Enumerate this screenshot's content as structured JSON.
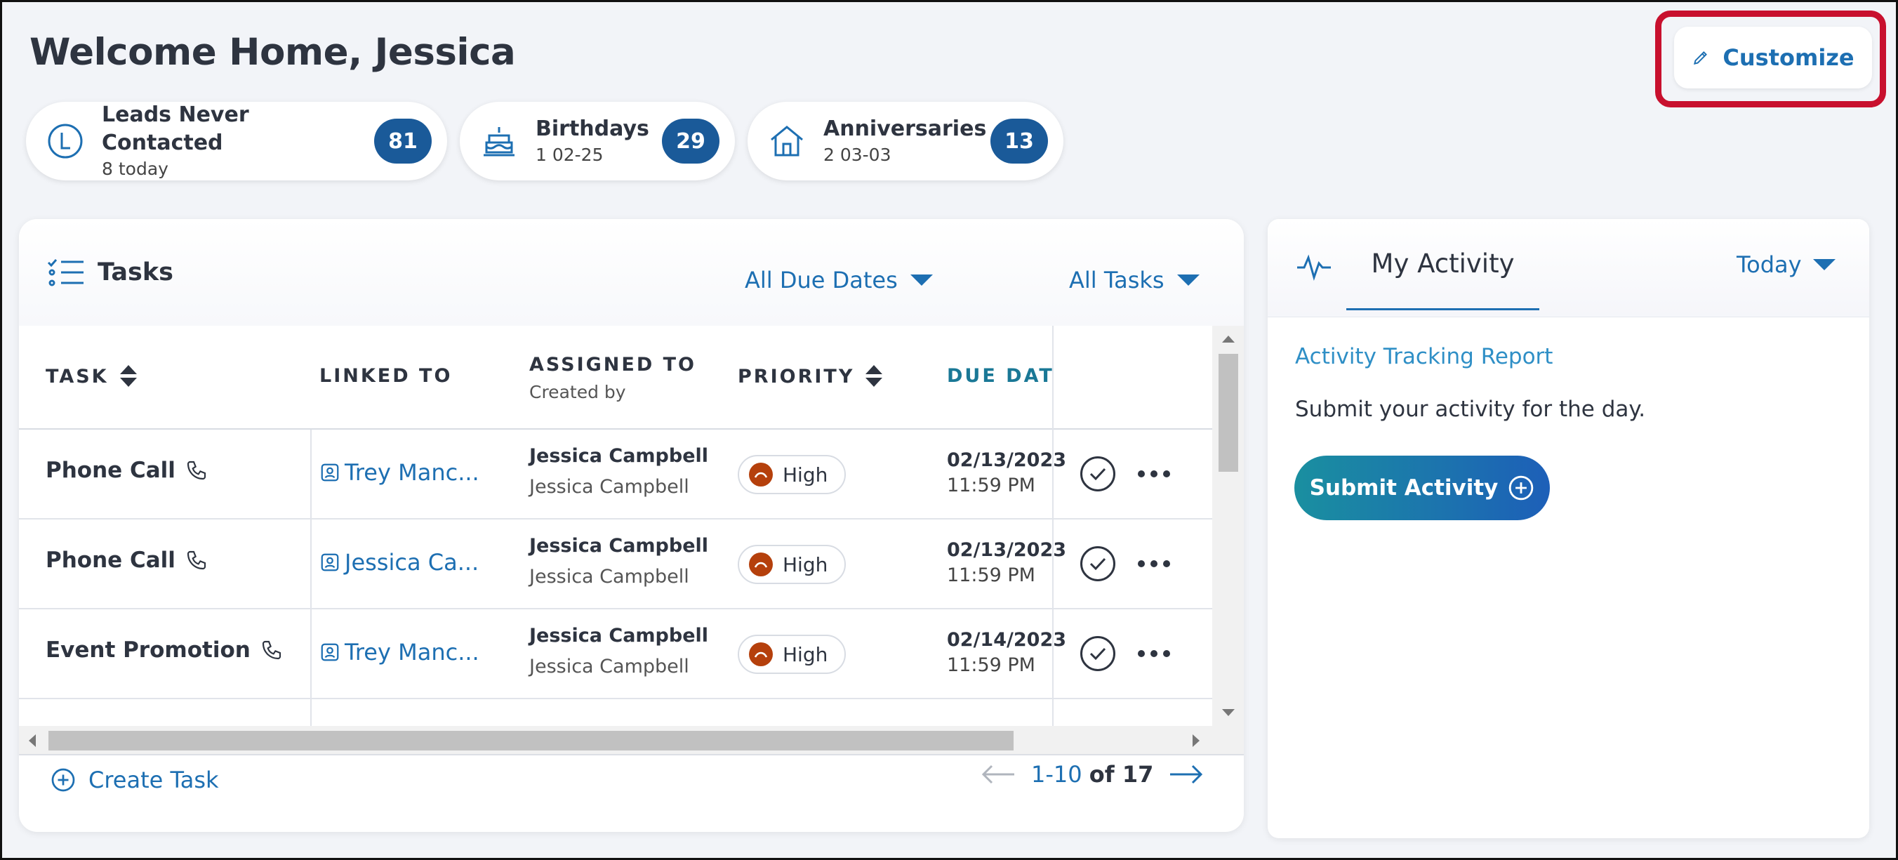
{
  "page": {
    "title": "Welcome Home, Jessica"
  },
  "customize": {
    "label": "Customize",
    "highlight_color": "#c8102e"
  },
  "stats": [
    {
      "label": "Leads Never Contacted",
      "sub": "8 today",
      "count": "81",
      "icon": "leads-icon"
    },
    {
      "label": "Birthdays",
      "sub": "1 02-25",
      "count": "29",
      "icon": "cake-icon"
    },
    {
      "label": "Anniversaries",
      "sub": "2 03-03",
      "count": "13",
      "icon": "home-icon"
    }
  ],
  "tasks": {
    "title": "Tasks",
    "filter_due": "All Due Dates",
    "filter_tasks": "All Tasks",
    "columns": {
      "task": "TASK",
      "linked": "LINKED TO",
      "assigned": "ASSIGNED TO",
      "assigned_sub": "Created by",
      "priority": "PRIORITY",
      "due": "DUE DATE"
    },
    "rows": [
      {
        "task": "Phone Call",
        "linked": "Trey Manc...",
        "assigned": "Jessica Campbell",
        "created": "Jessica Campbell",
        "priority": "High",
        "due_date": "02/13/2023",
        "due_time": "11:59 PM"
      },
      {
        "task": "Phone Call",
        "linked": "Jessica Ca...",
        "assigned": "Jessica Campbell",
        "created": "Jessica Campbell",
        "priority": "High",
        "due_date": "02/13/2023",
        "due_time": "11:59 PM"
      },
      {
        "task": "Event Promotion",
        "linked": "Trey Manc...",
        "assigned": "Jessica Campbell",
        "created": "Jessica Campbell",
        "priority": "High",
        "due_date": "02/14/2023",
        "due_time": "11:59 PM"
      }
    ],
    "create_label": "Create Task",
    "pager": {
      "range": "1-10",
      "of": "of 17"
    }
  },
  "activity": {
    "tab": "My Activity",
    "period": "Today",
    "report_link": "Activity Tracking Report",
    "submit_text": "Submit your activity for the day.",
    "submit_button": "Submit Activity"
  },
  "colors": {
    "accent": "#1d6fb2",
    "badge": "#1a5a99",
    "priority_high": "#b5400c"
  }
}
